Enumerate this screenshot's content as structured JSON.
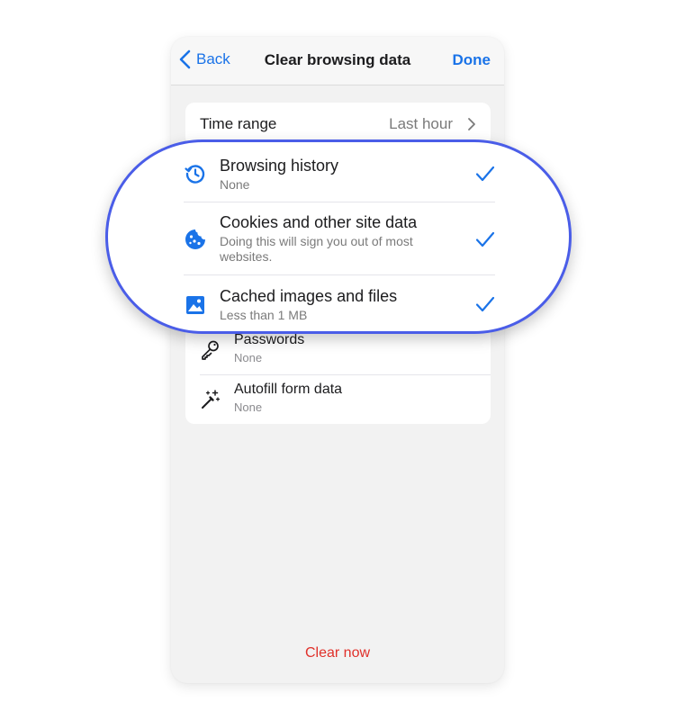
{
  "colors": {
    "accent": "#1a73e8",
    "highlight_border": "#4a5de8",
    "destructive": "#e0302a"
  },
  "navbar": {
    "back_label": "Back",
    "title": "Clear browsing data",
    "done_label": "Done"
  },
  "time_range": {
    "label": "Time range",
    "value": "Last hour"
  },
  "highlighted_items": [
    {
      "title": "Browsing history",
      "subtitle": "None",
      "icon": "history-icon",
      "checked": true
    },
    {
      "title": "Cookies and other site data",
      "subtitle": "Doing this will sign you out of most websites.",
      "icon": "cookie-icon",
      "checked": true
    },
    {
      "title": "Cached images and files",
      "subtitle": "Less than 1 MB",
      "icon": "image-icon",
      "checked": true
    }
  ],
  "other_items": [
    {
      "title": "Passwords",
      "subtitle": "None",
      "icon": "key-icon",
      "checked": false
    },
    {
      "title": "Autofill form data",
      "subtitle": "None",
      "icon": "magic-wand-icon",
      "checked": false
    }
  ],
  "clear_label": "Clear now"
}
